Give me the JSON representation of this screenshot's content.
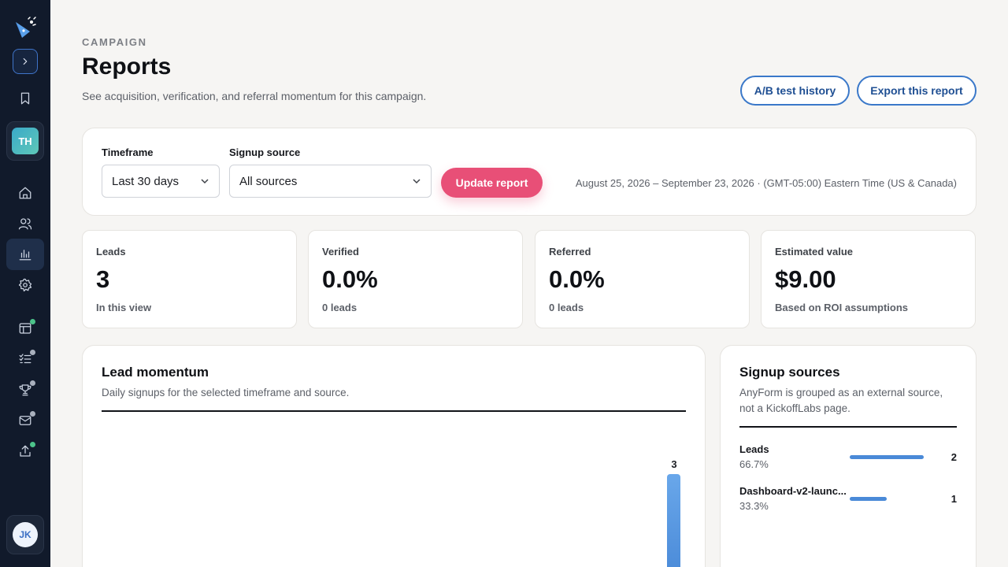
{
  "sidebar": {
    "team_initials": "TH",
    "user_initials": "JK",
    "icons": [
      "logo-icon",
      "chevron-right-icon",
      "bookmark-icon",
      "home-icon",
      "users-icon",
      "bar-chart-icon",
      "gear-icon",
      "layout-icon",
      "checklist-icon",
      "trophy-icon",
      "mail-icon",
      "upload-icon"
    ],
    "dot_colors": {
      "green": "#4cc38a",
      "gray": "#a9b0bd"
    }
  },
  "header": {
    "eyebrow": "CAMPAIGN",
    "title": "Reports",
    "subtitle": "See acquisition, verification, and referral momentum for this campaign.",
    "ab_history_label": "A/B test history",
    "export_label": "Export this report"
  },
  "filters": {
    "timeframe_label": "Timeframe",
    "timeframe_value": "Last 30 days",
    "source_label": "Signup source",
    "source_value": "All sources",
    "update_label": "Update report",
    "date_range": "August 25, 2026 – September 23, 2026 · (GMT-05:00) Eastern Time (US & Canada)"
  },
  "stats": [
    {
      "label": "Leads",
      "value": "3",
      "sub": "In this view"
    },
    {
      "label": "Verified",
      "value": "0.0%",
      "sub": "0 leads"
    },
    {
      "label": "Referred",
      "value": "0.0%",
      "sub": "0 leads"
    },
    {
      "label": "Estimated value",
      "value": "$9.00",
      "sub": "Based on ROI assumptions"
    }
  ],
  "momentum": {
    "title": "Lead momentum",
    "desc": "Daily signups for the selected timeframe and source.",
    "bar_value_label": "3"
  },
  "sources": {
    "title": "Signup sources",
    "desc": "AnyForm is grouped as an external source, not a KickoffLabs page.",
    "items": [
      {
        "name": "Leads",
        "pct": "66.7%",
        "count": "2",
        "share": 0.667
      },
      {
        "name": "Dashboard-v2-launc...",
        "pct": "33.3%",
        "count": "1",
        "share": 0.333
      }
    ]
  },
  "colors": {
    "accent_primary": "#e84f77",
    "accent_blue": "#3a78c9",
    "sidebar_bg": "#111a2b",
    "bar_blue": "#4a8ad8"
  }
}
